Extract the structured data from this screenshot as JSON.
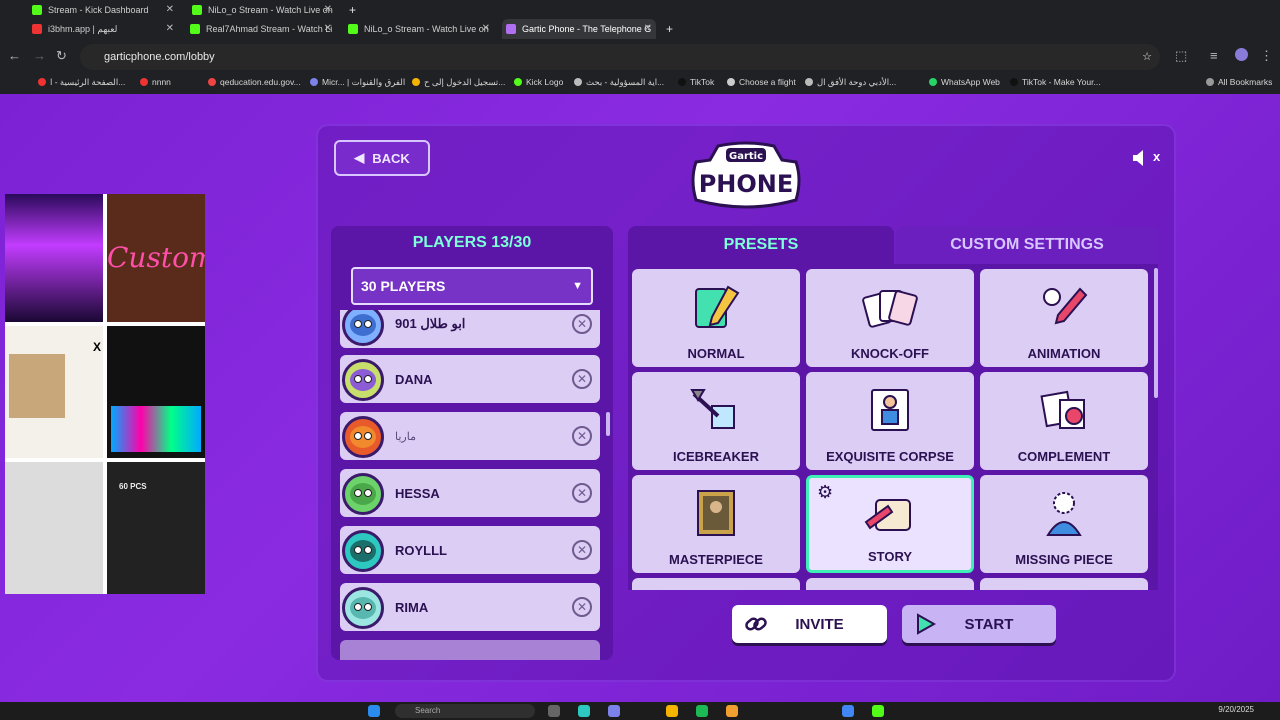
{
  "browser": {
    "tabs": [
      {
        "title": "Stream - Kick Dashboard"
      },
      {
        "title": "NiLo_o Stream - Watch Live on"
      },
      {
        "title": "i3bhm.app | لعبهم"
      },
      {
        "title": "Real7Ahmad Stream - Watch Li"
      },
      {
        "title": "NiLo_o Stream - Watch Live on"
      },
      {
        "title": "Gartic Phone - The Telephone G"
      }
    ],
    "url": "garticphone.com/lobby",
    "bookmarks": [
      "الصفحة الرئيسية - ا...",
      "nnnn",
      "qeducation.edu.gov...",
      "Micr... | الفرق والقنوات",
      "تسجيل الدخول إلى ح...",
      "Kick Logo",
      "اية المسؤولية - بحث...",
      "TikTok",
      "Choose a flight",
      "الأدبي دوحة الأفق ال...",
      "WhatsApp Web",
      "TikTok - Make Your..."
    ],
    "all_bookmarks": "All Bookmarks"
  },
  "game": {
    "back_label": "BACK",
    "logo_top": "Gartic",
    "logo_main": "PHONE",
    "mute_label": "x",
    "players_title": "PLAYERS 13/30",
    "players_select": "30 PLAYERS",
    "players": [
      {
        "name": "901 ابو طلال",
        "color": "#7fb0ff"
      },
      {
        "name": "DANA",
        "color": "#c7e06b"
      },
      {
        "name": "ماريا",
        "color": "#e85a2a"
      },
      {
        "name": "HESSA",
        "color": "#6cd36a"
      },
      {
        "name": "ROYLLL",
        "color": "#2dc8c0"
      },
      {
        "name": "RIMA",
        "color": "#9be6e0"
      }
    ],
    "tab_presets": "PRESETS",
    "tab_custom": "CUSTOM SETTINGS",
    "presets": [
      {
        "label": "NORMAL",
        "icon": "pencil-notebook-icon"
      },
      {
        "label": "KNOCK-OFF",
        "icon": "cards-icon"
      },
      {
        "label": "ANIMATION",
        "icon": "animation-brush-icon"
      },
      {
        "label": "ICEBREAKER",
        "icon": "ice-pick-icon"
      },
      {
        "label": "EXQUISITE CORPSE",
        "icon": "paper-figure-icon"
      },
      {
        "label": "COMPLEMENT",
        "icon": "puzzle-paper-icon"
      },
      {
        "label": "MASTERPIECE",
        "icon": "painting-icon"
      },
      {
        "label": "STORY",
        "icon": "scroll-quill-icon"
      },
      {
        "label": "MISSING PIECE",
        "icon": "missing-head-icon"
      }
    ],
    "selected_preset": "STORY",
    "invite_label": "INVITE",
    "start_label": "START"
  },
  "taskbar": {
    "search": "Search",
    "date": "9/20/2025"
  },
  "overlay": {
    "badge": "60 PCS",
    "tag": "Custom"
  },
  "colors": {
    "accent": "#7dffd8",
    "bg": "#7c22d4",
    "selected_border": "#3ef0b5"
  }
}
